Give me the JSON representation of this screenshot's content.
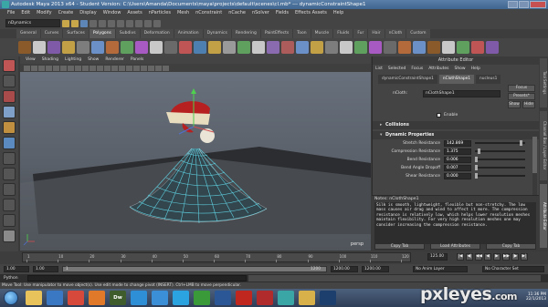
{
  "window": {
    "title": "Autodesk Maya 2013 x64 - Student Version: C:\\Users\\Amanda\\Documents\\maya\\projects\\default\\scenes\\cl.mb*  ---  dynamicConstraintShape1"
  },
  "menubar": [
    "File",
    "Edit",
    "Modify",
    "Create",
    "Display",
    "Window",
    "Assets",
    "nParticles",
    "Mesh",
    "nConstraint",
    "nCache",
    "nSolver",
    "Fields",
    "Effects Assets",
    "Help"
  ],
  "statusline": {
    "mode": "nDynamics"
  },
  "shelf": {
    "tabs": [
      "General",
      "Curves",
      "Surfaces",
      "Polygons",
      "Subdivs",
      "Deformation",
      "Animation",
      "Dynamics",
      "Rendering",
      "PaintEffects",
      "Toon",
      "Muscle",
      "Fluids",
      "Fur",
      "Hair",
      "nCloth",
      "Custom"
    ],
    "active_tab": 3,
    "icon_colors": [
      "#8b5a2b",
      "#c9c9c9",
      "#7f5aa8",
      "#c2a046",
      "#7d7d7d",
      "#6b8fc7",
      "#b56a3c",
      "#5fa05f",
      "#a75ac2",
      "#c8c8c8",
      "#6a6a6a",
      "#c05555",
      "#4d7fb0",
      "#c2a046",
      "#9a9a9a",
      "#5fa05f",
      "#c8c8c8",
      "#8b6bb0",
      "#ad5c5c",
      "#6b8fc7",
      "#c2a046",
      "#7d7d7d",
      "#c8c8c8",
      "#5fa05f",
      "#a75ac2",
      "#6a6a6a",
      "#b56a3c",
      "#6b8fc7",
      "#8b5a2b",
      "#c8c8c8",
      "#5fa05f",
      "#c05555",
      "#7f5aa8"
    ]
  },
  "viewport": {
    "menus": [
      "View",
      "Shading",
      "Lighting",
      "Show",
      "Renderer",
      "Panels"
    ],
    "camera_label": "persp"
  },
  "attribute_editor": {
    "title": "Attribute Editor",
    "menus": [
      "List",
      "Selected",
      "Focus",
      "Attributes",
      "Show",
      "Help"
    ],
    "tabs": [
      "dynamicConstraintShape1",
      "nClothShape1",
      "nucleus1"
    ],
    "active_tab": 1,
    "node_label": "nCloth:",
    "node_name": "nClothShape1",
    "buttons": {
      "focus": "Focus",
      "presets": "Presets*",
      "show": "Show",
      "hide": "Hide"
    },
    "enable_label": "Enable",
    "sections": {
      "collisions": "Collisions",
      "dynamic_properties": "Dynamic Properties"
    },
    "attributes": [
      {
        "label": "Stretch Resistance",
        "value": "142.869",
        "level": 0.95
      },
      {
        "label": "Compression Resistance",
        "value": "1.375",
        "level": 0.05
      },
      {
        "label": "Bend Resistance",
        "value": "0.006",
        "level": 0.0
      },
      {
        "label": "Bend Angle Dropoff",
        "value": "0.007",
        "level": 0.0
      },
      {
        "label": "Shear Resistance",
        "value": "0.000",
        "level": 0.0
      }
    ]
  },
  "notes": {
    "title": "Notes: nClothShape1",
    "text": "Silk is smooth, lightweight, flexible but non-stretchy. The low mass causes air drag and wind to affect it more. The compression resistance is relatively low, which helps lower resolution meshes maintain flexibility. For very high resolution meshes one may consider increasing the compression resistance.",
    "buttons": [
      "Copy Tab",
      "Load Attributes",
      "Copy Tab"
    ]
  },
  "side_tabs": [
    "Tool Settings",
    "Channel Box / Layer Editor",
    "Attribute Editor"
  ],
  "time_slider": {
    "labels": [
      "1",
      "10",
      "20",
      "30",
      "40",
      "50",
      "60",
      "70",
      "80",
      "90",
      "100",
      "110",
      "120"
    ],
    "current_frame": "125.00",
    "playback": [
      "|◀",
      "◀|",
      "◀◀",
      "◀",
      "▶",
      "▶▶",
      "|▶",
      "▶|"
    ]
  },
  "range_bar": {
    "start": "1.00",
    "inner_start": "1.00",
    "marker": "1",
    "inner_end": "1200",
    "end": "1200.00",
    "end2": "1200.00",
    "anim_layer": "No Anim Layer",
    "char_set": "No Character Set"
  },
  "command_line": {
    "language": "Python"
  },
  "help_line": "Move Tool: Use manipulator to move object(s). Use edit mode to change pivot (INSERT). Ctrl+LMB to move perpendicular.",
  "taskbar": {
    "items": [
      {
        "name": "explorer",
        "color": "#e8c25a",
        "label": ""
      },
      {
        "name": "media",
        "color": "#3b78c4",
        "label": ""
      },
      {
        "name": "chrome",
        "color": "#d6493b",
        "label": ""
      },
      {
        "name": "firefox",
        "color": "#e07a2a",
        "label": ""
      },
      {
        "name": "dreamweaver",
        "color": "#3e5c2c",
        "label": "Dw"
      },
      {
        "name": "windows",
        "color": "#2f8fd6",
        "label": ""
      },
      {
        "name": "ie",
        "color": "#3b8fd6",
        "label": ""
      },
      {
        "name": "skype",
        "color": "#2aa3e0",
        "label": ""
      },
      {
        "name": "brazil",
        "color": "#3a9a3a",
        "label": ""
      },
      {
        "name": "word",
        "color": "#2b5797",
        "label": ""
      },
      {
        "name": "acrobat",
        "color": "#c0271f",
        "label": ""
      },
      {
        "name": "adobe",
        "color": "#b02b2b",
        "label": ""
      },
      {
        "name": "maya",
        "color": "#3aa6a6",
        "label": ""
      },
      {
        "name": "folder",
        "color": "#d8b14a",
        "label": ""
      },
      {
        "name": "photoshop",
        "color": "#1d3f6e",
        "label": ""
      }
    ],
    "clock_time": "11:36 PM",
    "clock_date": "22/1/2013"
  },
  "watermark": {
    "brand": "pxleyes",
    "tld": ".com"
  }
}
